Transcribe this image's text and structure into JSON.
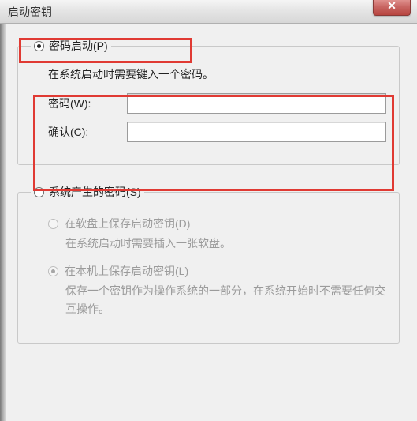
{
  "window": {
    "title": "启动密钥"
  },
  "password_startup": {
    "legend": "密码启动(P)",
    "hint": "在系统启动时需要键入一个密码。",
    "password_label": "密码(W):",
    "confirm_label": "确认(C):",
    "password_value": "",
    "confirm_value": ""
  },
  "system_generated": {
    "legend": "系统产生的密码(S)",
    "floppy": {
      "label": "在软盘上保存启动密钥(D)",
      "hint": "在系统启动时需要插入一张软盘。"
    },
    "local": {
      "label": "在本机上保存启动密钥(L)",
      "hint": "保存一个密钥作为操作系统的一部分，在系统开始时不需要任何交互操作。"
    }
  },
  "close_glyph": "✕"
}
